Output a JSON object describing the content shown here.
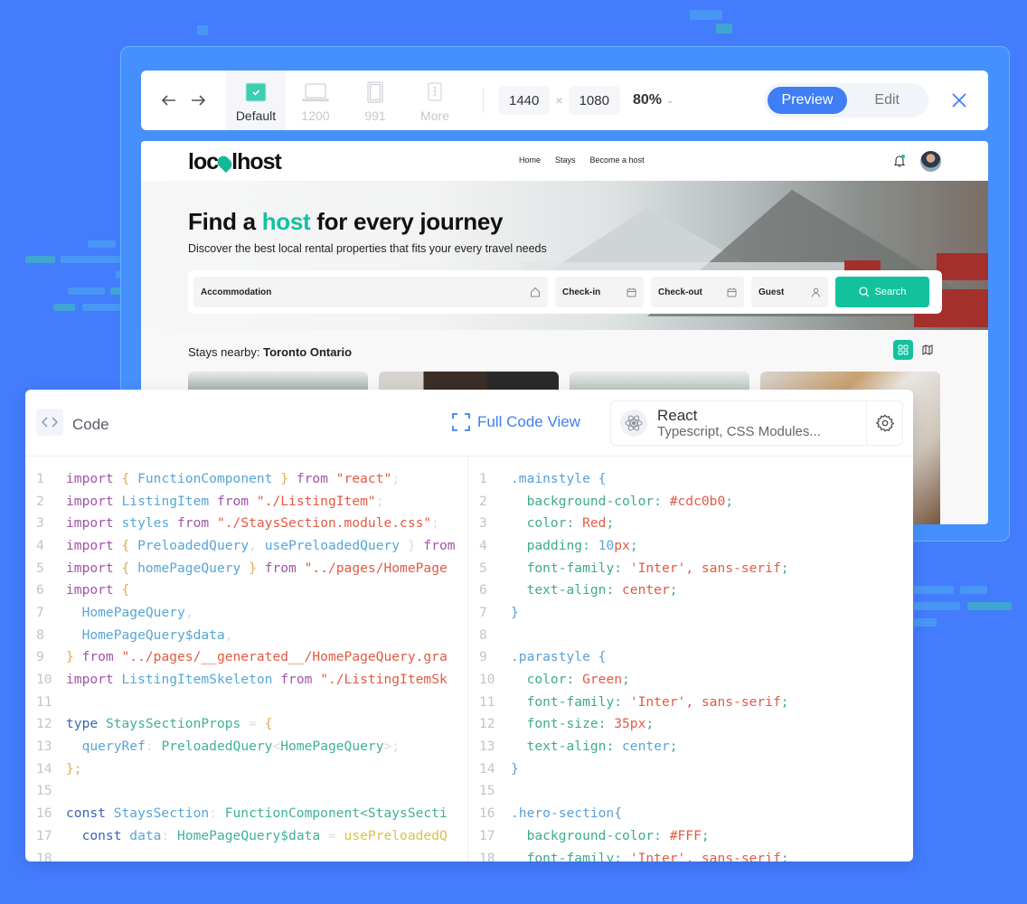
{
  "toolbar": {
    "devices": [
      {
        "label": "Default",
        "icon": "check-square-icon",
        "active": true
      },
      {
        "label": "1200",
        "icon": "laptop-icon",
        "active": false
      },
      {
        "label": "991",
        "icon": "tablet-icon",
        "active": false
      },
      {
        "label": "More",
        "icon": "more-device-icon",
        "active": false
      }
    ],
    "width": "1440",
    "height": "1080",
    "times": "×",
    "zoom": "80%",
    "modes": {
      "preview": "Preview",
      "edit": "Edit"
    },
    "active_mode": "Preview"
  },
  "site": {
    "logo_left": "loc",
    "logo_right": "lhost",
    "nav": [
      "Home",
      "Stays",
      "Become a host"
    ],
    "hero": {
      "title_before": "Find a ",
      "title_accent": "host",
      "title_after": " for every journey",
      "subtitle": "Discover the best local rental properties that fits your every travel needs"
    },
    "search": {
      "accommodation": "Accommodation",
      "checkin": "Check-in",
      "checkout": "Check-out",
      "guest": "Guest",
      "button": "Search"
    },
    "stays": {
      "prefix": "Stays nearby: ",
      "location": "Toronto Ontario"
    },
    "accent_color": "#13c1a0"
  },
  "code_panel": {
    "title": "Code",
    "full_view": "Full Code View",
    "framework": {
      "name": "React",
      "detail": "Typescript, CSS Modules..."
    },
    "tsx_lines": [
      [
        [
          "k",
          "import "
        ],
        [
          "p",
          "{ "
        ],
        [
          "v",
          "FunctionComponent "
        ],
        [
          "p",
          "} "
        ],
        [
          "k",
          "from "
        ],
        [
          "s",
          "\"react\""
        ],
        [
          "dim",
          ";"
        ]
      ],
      [
        [
          "k",
          "import "
        ],
        [
          "v",
          "ListingItem "
        ],
        [
          "k",
          "from "
        ],
        [
          "s",
          "\"./ListingItem\""
        ],
        [
          "dim",
          ";"
        ]
      ],
      [
        [
          "k",
          "import "
        ],
        [
          "v",
          "styles "
        ],
        [
          "k",
          "from "
        ],
        [
          "s",
          "\"./StaysSection.module.css\""
        ],
        [
          "dim",
          ";"
        ]
      ],
      [
        [
          "k",
          "import "
        ],
        [
          "p",
          "{ "
        ],
        [
          "v",
          "PreloadedQuery"
        ],
        [
          "dim",
          ", "
        ],
        [
          "v",
          "usePreloadedQuery "
        ],
        [
          "dim",
          "} "
        ],
        [
          "k",
          "from"
        ]
      ],
      [
        [
          "k",
          "import "
        ],
        [
          "p",
          "{ "
        ],
        [
          "v",
          "homePageQuery "
        ],
        [
          "p",
          "} "
        ],
        [
          "k",
          "from "
        ],
        [
          "s",
          "\"../pages/HomePage"
        ]
      ],
      [
        [
          "k",
          "import "
        ],
        [
          "p",
          "{"
        ]
      ],
      [
        [
          "ct",
          "  "
        ],
        [
          "v",
          "HomePageQuery"
        ],
        [
          "dim",
          ","
        ]
      ],
      [
        [
          "ct",
          "  "
        ],
        [
          "v",
          "HomePageQuery$data"
        ],
        [
          "dim",
          ","
        ]
      ],
      [
        [
          "p",
          "} "
        ],
        [
          "k",
          "from "
        ],
        [
          "s",
          "\"../pages/__generated__/HomePageQuery.gra"
        ]
      ],
      [
        [
          "k",
          "import "
        ],
        [
          "v",
          "ListingItemSkeleton "
        ],
        [
          "k",
          "from "
        ],
        [
          "s",
          "\"./ListingItemSk"
        ]
      ],
      [],
      [
        [
          "kb",
          "type "
        ],
        [
          "ty",
          "StaysSectionProps "
        ],
        [
          "dim",
          "= "
        ],
        [
          "p",
          "{"
        ]
      ],
      [
        [
          "ct",
          "  "
        ],
        [
          "v",
          "queryRef"
        ],
        [
          "dim",
          ": "
        ],
        [
          "ty",
          "PreloadedQuery"
        ],
        [
          "dim",
          "<"
        ],
        [
          "ty",
          "HomePageQuery"
        ],
        [
          "dim",
          ">;"
        ]
      ],
      [
        [
          "p",
          "};"
        ]
      ],
      [],
      [
        [
          "kb",
          "const "
        ],
        [
          "v",
          "StaysSection"
        ],
        [
          "dim",
          ": "
        ],
        [
          "ty",
          "FunctionComponent<StaysSecti"
        ]
      ],
      [
        [
          "ct",
          "  "
        ],
        [
          "kb",
          "const "
        ],
        [
          "v",
          "data"
        ],
        [
          "dim",
          ": "
        ],
        [
          "ty",
          "HomePageQuery$data "
        ],
        [
          "dim",
          "= "
        ],
        [
          "fn",
          "usePreloadedQ"
        ]
      ],
      []
    ],
    "css_lines": [
      [
        [
          "sel",
          ".mainstyle {"
        ]
      ],
      [
        [
          "ct",
          "  "
        ],
        [
          "prop",
          "background-color: "
        ],
        [
          "val",
          "#cdc0b0"
        ],
        [
          "prop",
          ";"
        ]
      ],
      [
        [
          "ct",
          "  "
        ],
        [
          "prop",
          "color: "
        ],
        [
          "val",
          "Red"
        ],
        [
          "prop",
          ";"
        ]
      ],
      [
        [
          "ct",
          "  "
        ],
        [
          "prop",
          "padding: "
        ],
        [
          "num",
          "10"
        ],
        [
          "val",
          "px"
        ],
        [
          "prop",
          ";"
        ]
      ],
      [
        [
          "ct",
          "  "
        ],
        [
          "prop",
          "font-family: "
        ],
        [
          "val",
          "'Inter', sans-serif"
        ],
        [
          "prop",
          ";"
        ]
      ],
      [
        [
          "ct",
          "  "
        ],
        [
          "prop",
          "text-align: "
        ],
        [
          "val",
          "center"
        ],
        [
          "prop",
          ";"
        ]
      ],
      [
        [
          "sel",
          "}"
        ]
      ],
      [],
      [
        [
          "sel",
          ".parastyle {"
        ]
      ],
      [
        [
          "ct",
          "  "
        ],
        [
          "prop",
          "color: "
        ],
        [
          "val",
          "Green"
        ],
        [
          "prop",
          ";"
        ]
      ],
      [
        [
          "ct",
          "  "
        ],
        [
          "prop",
          "font-family: "
        ],
        [
          "val",
          "'Inter', sans-serif"
        ],
        [
          "prop",
          ";"
        ]
      ],
      [
        [
          "ct",
          "  "
        ],
        [
          "prop",
          "font-size: "
        ],
        [
          "val",
          "35px"
        ],
        [
          "prop",
          ";"
        ]
      ],
      [
        [
          "ct",
          "  "
        ],
        [
          "prop",
          "text-align: "
        ],
        [
          "num",
          "center"
        ],
        [
          "prop",
          ";"
        ]
      ],
      [
        [
          "sel",
          "}"
        ]
      ],
      [],
      [
        [
          "sel",
          ".hero-section{"
        ]
      ],
      [
        [
          "ct",
          "  "
        ],
        [
          "prop",
          "background-color: "
        ],
        [
          "val",
          "#FFF"
        ],
        [
          "prop",
          ";"
        ]
      ],
      [
        [
          "ct",
          "  "
        ],
        [
          "prop",
          "font-family: "
        ],
        [
          "val",
          "'Inter', sans-serif"
        ],
        [
          "prop",
          ";"
        ]
      ]
    ]
  }
}
